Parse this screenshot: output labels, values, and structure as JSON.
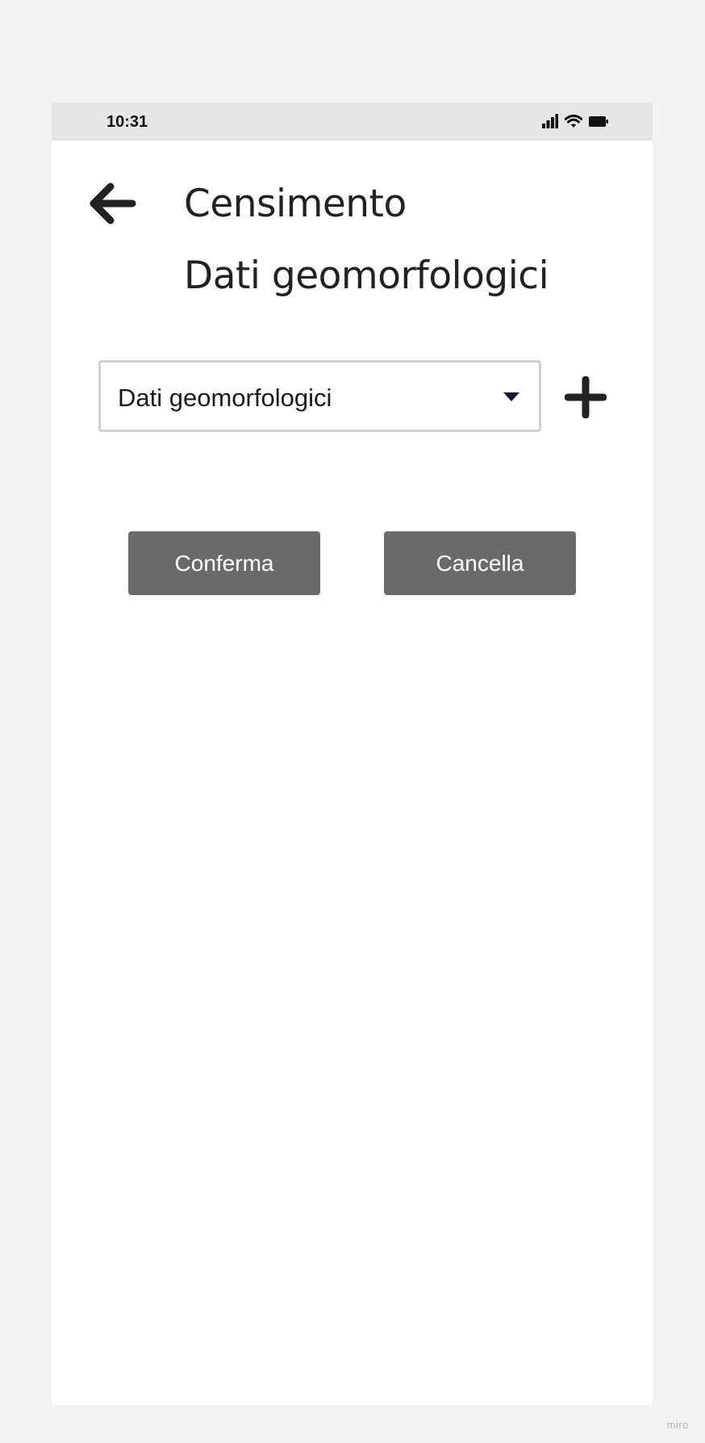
{
  "status_bar": {
    "time": "10:31",
    "icons": [
      "cellular-signal-icon",
      "wifi-icon",
      "battery-icon"
    ]
  },
  "header": {
    "back_icon": "arrow-left-icon",
    "title": "Censimento",
    "subtitle": "Dati geomorfologici"
  },
  "form": {
    "select": {
      "selected_value": "Dati geomorfologici",
      "caret_icon": "caret-down-icon"
    },
    "add_icon": "plus-icon"
  },
  "actions": {
    "confirm_label": "Conferma",
    "cancel_label": "Cancella"
  },
  "watermark": "miro",
  "colors": {
    "background": "#f2f2f2",
    "status_bar": "#e6e6e6",
    "button": "#6a6a6a",
    "button_text": "#ffffff",
    "text": "#222222",
    "caret": "#1a1033"
  }
}
